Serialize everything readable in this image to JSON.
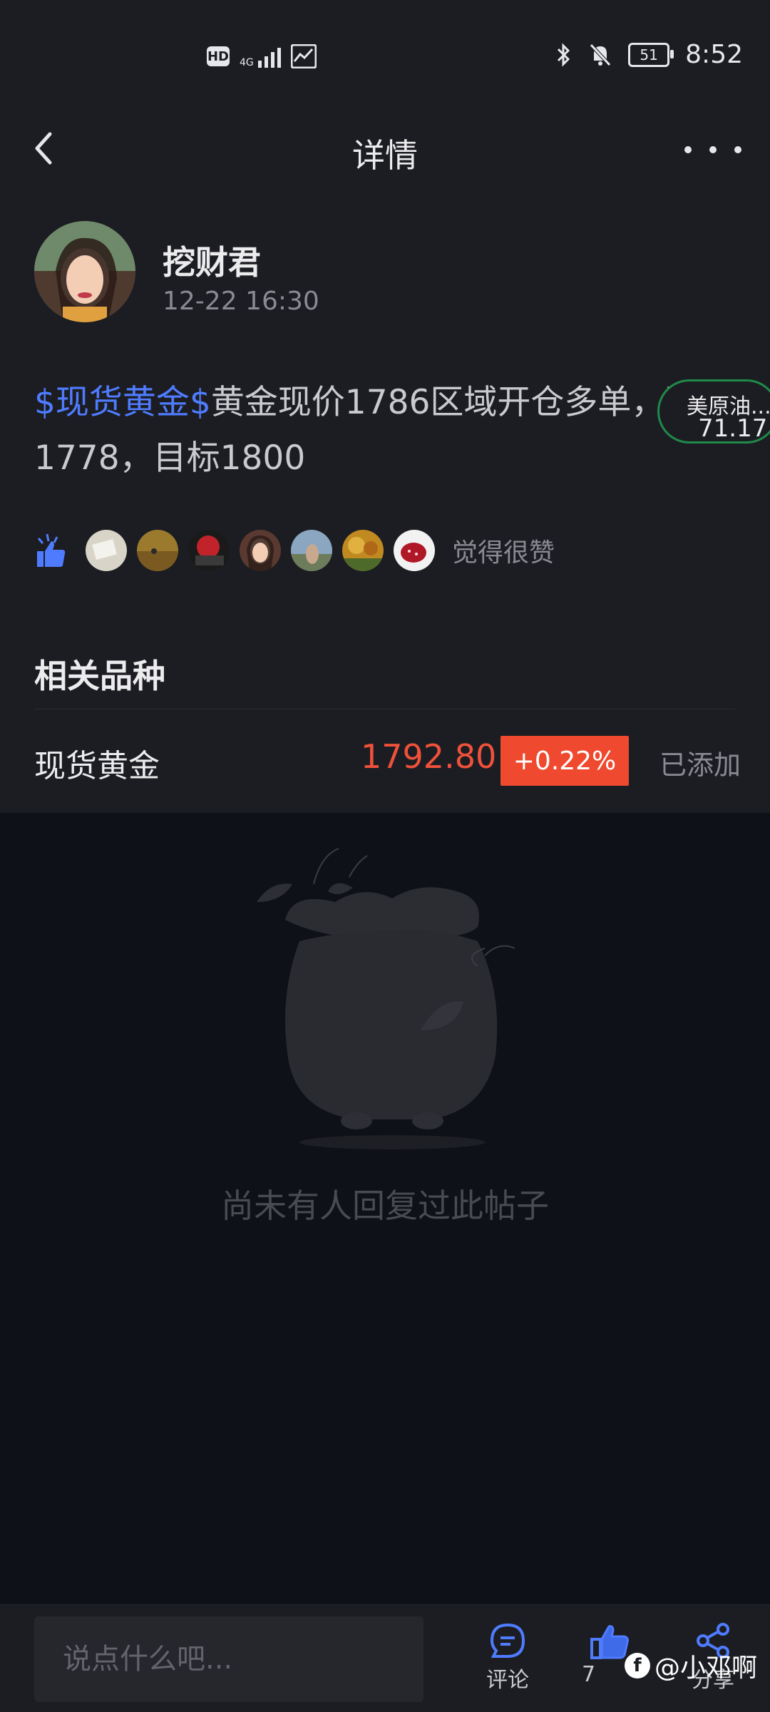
{
  "status_bar": {
    "hd": "HD",
    "network": "4G",
    "time": "8:52",
    "battery": "51"
  },
  "header": {
    "title": "详情"
  },
  "post": {
    "author": "挖财君",
    "time": "12-22 16:30",
    "tag": "$现货黄金$",
    "text": "黄金现价1786区域开仓多单，防1 1778，目标1800",
    "likes_label": "觉得很赞"
  },
  "floating_quote": {
    "name": "美原油...",
    "value": "71.17"
  },
  "related": {
    "title": "相关品种",
    "items": [
      {
        "name": "现货黄金",
        "price": "1792.80",
        "change": "+0.22%",
        "status": "已添加"
      }
    ]
  },
  "empty_state": {
    "text": "尚未有人回复过此帖子"
  },
  "bottom_bar": {
    "input_placeholder": "说点什么吧...",
    "comment_label": "评论",
    "like_count": "7",
    "share_label": "分享"
  },
  "watermark": {
    "text": "@小邓啊"
  },
  "colors": {
    "accent_blue": "#4f7cff",
    "price_red": "#f0513a",
    "change_bg": "#ef4a2f",
    "pill_green": "#1f8a4a"
  }
}
